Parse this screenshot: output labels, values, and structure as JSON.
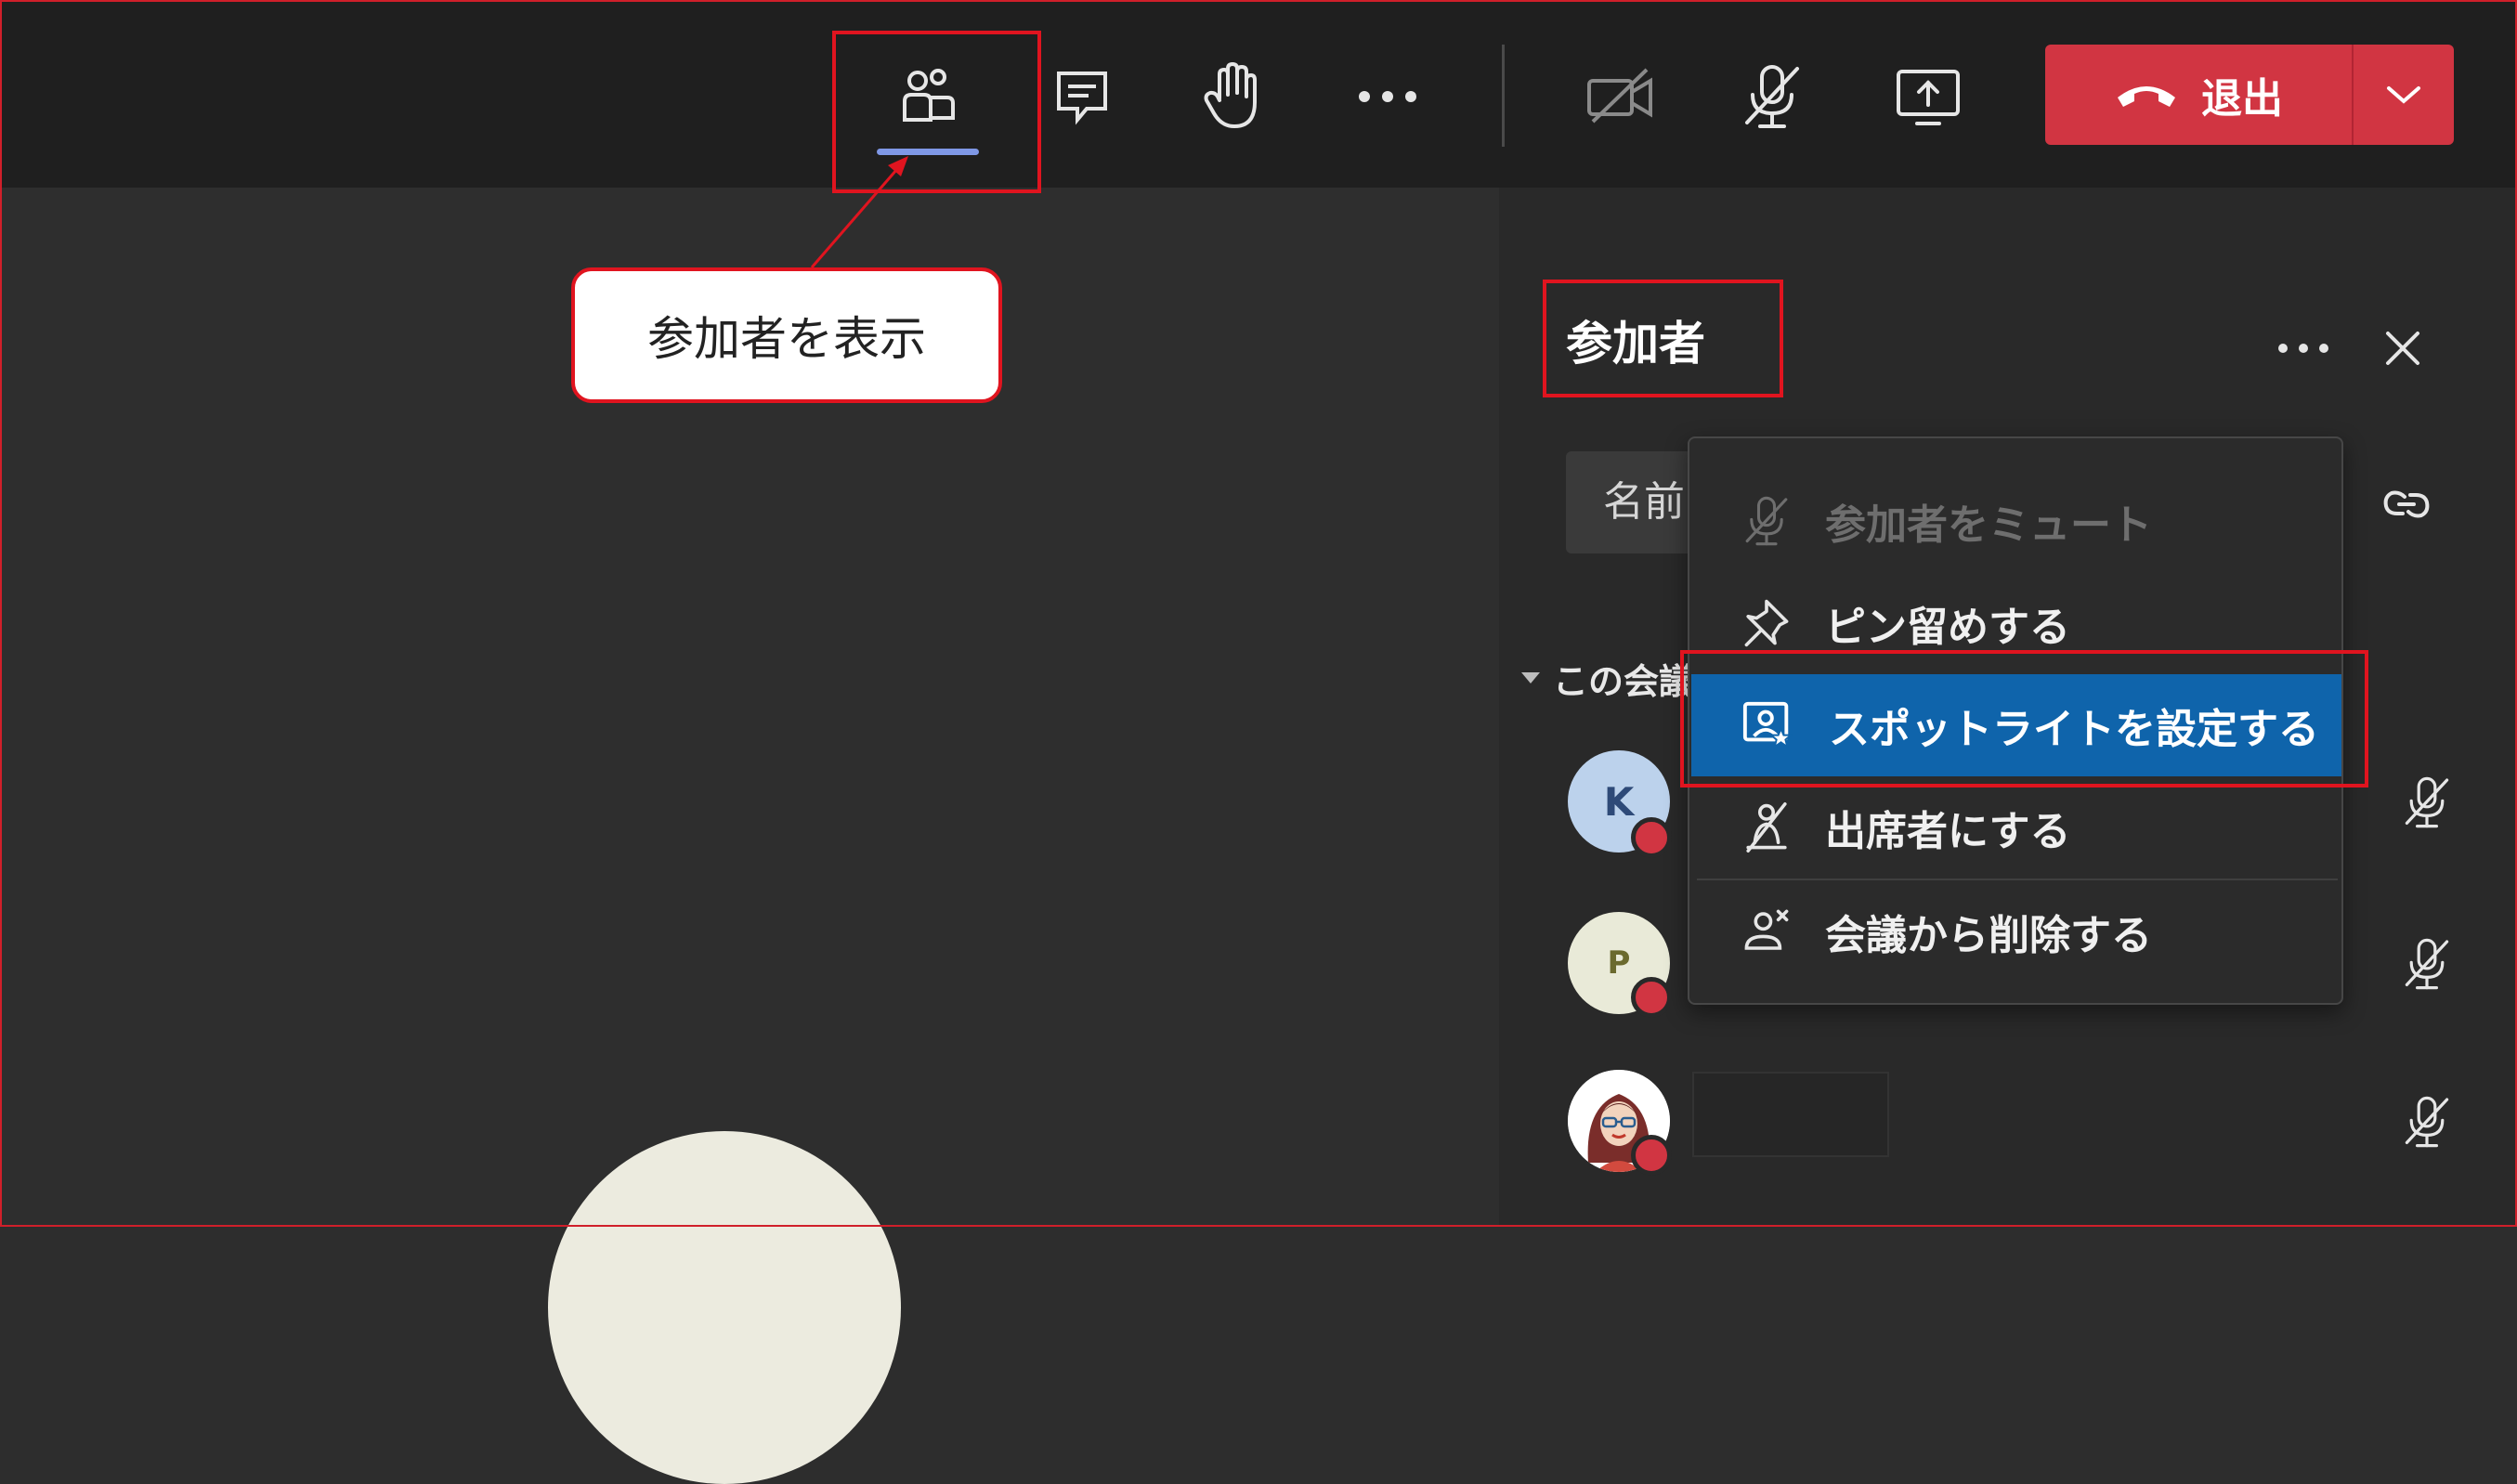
{
  "toolbar": {
    "participants_icon": "people-icon",
    "chat_icon": "chat-icon",
    "raise_hand_icon": "raise-hand-icon",
    "more_icon": "more-icon",
    "camera_icon": "camera-off-icon",
    "mic_icon": "mic-off-icon",
    "share_icon": "share-screen-icon",
    "leave_label": "退出",
    "leave_icon": "phone-hangup-icon",
    "leave_dropdown_icon": "chevron-down-icon"
  },
  "callout": {
    "text": "参加者を表示"
  },
  "panel": {
    "title": "参加者",
    "search_placeholder": "名前",
    "section_label": "この会議",
    "participants": [
      {
        "initial": "K",
        "bg": "#bcd2ec",
        "fg": "#2e4a78"
      },
      {
        "initial": "P",
        "bg": "#e9ead8",
        "fg": "#6b6a2e"
      },
      {
        "initial": "",
        "bg": "#ffffff",
        "fg": "#000000"
      }
    ]
  },
  "context_menu": {
    "items": [
      {
        "label": "参加者をミュート",
        "icon": "mic-off-icon",
        "disabled": true
      },
      {
        "label": "ピン留めする",
        "icon": "pin-icon",
        "disabled": false
      },
      {
        "label": "スポットライトを設定する",
        "icon": "spotlight-icon",
        "disabled": false,
        "highlighted": true
      },
      {
        "label": "出席者にする",
        "icon": "attendee-icon",
        "disabled": false
      },
      {
        "label": "会議から削除する",
        "icon": "remove-person-icon",
        "disabled": false
      }
    ]
  },
  "colors": {
    "accent_red": "#d13542",
    "highlight_blue": "#0f64ab",
    "annotation_red": "#e0141f",
    "tab_underline": "#7f98e6"
  }
}
